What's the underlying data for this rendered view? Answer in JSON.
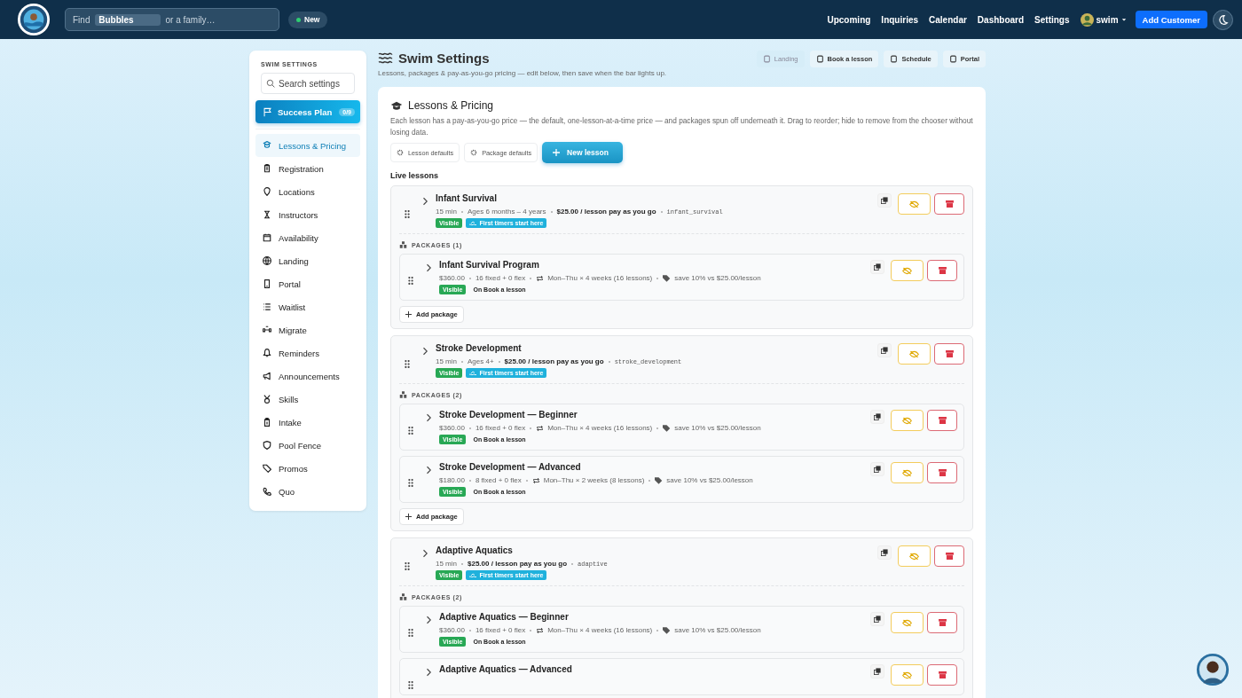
{
  "header": {
    "search": {
      "placeholder": "Find **Bubbles** or a family…"
    },
    "new_button": "New",
    "nav": [
      "Upcoming",
      "Inquiries",
      "Calendar",
      "Dashboard",
      "Settings"
    ],
    "user": "swim",
    "add_customer": "Add Customer"
  },
  "sidebar": {
    "heading": "SWIM SETTINGS",
    "search": {
      "placeholder": "Search settings"
    },
    "success_plan": {
      "label": "Success Plan",
      "count": "0/9"
    },
    "items": [
      {
        "label": "Lessons & Pricing",
        "selected": true
      },
      {
        "label": "Registration",
        "selected": false
      },
      {
        "label": "Locations",
        "selected": false
      },
      {
        "label": "Instructors",
        "selected": false
      },
      {
        "label": "Availability",
        "selected": false
      },
      {
        "label": "Landing",
        "selected": false
      },
      {
        "label": "Portal",
        "selected": false
      },
      {
        "label": "Waitlist",
        "selected": false
      },
      {
        "label": "Migrate",
        "selected": false
      },
      {
        "label": "Reminders",
        "selected": false
      },
      {
        "label": "Announcements",
        "selected": false
      },
      {
        "label": "Skills",
        "selected": false
      },
      {
        "label": "Intake",
        "selected": false
      },
      {
        "label": "Pool Fence",
        "selected": false
      },
      {
        "label": "Promos",
        "selected": false
      },
      {
        "label": "Quo",
        "selected": false
      }
    ]
  },
  "page": {
    "title": "Swim Settings",
    "subtitle": "Lessons, packages & pay-as-you-go pricing — edit below, then save when the bar lights up.",
    "links": [
      {
        "label": "Landing",
        "disabled": true
      },
      {
        "label": "Book a lesson",
        "disabled": false
      },
      {
        "label": "Schedule",
        "disabled": false
      },
      {
        "label": "Portal",
        "disabled": false
      }
    ]
  },
  "card": {
    "title": "Lessons & Pricing",
    "description": "Each lesson has a pay-as-you-go price — the default, one-lesson-at-a-time price — and packages spun off underneath it. Drag to reorder; hide to remove from the chooser without losing data.",
    "buttons": [
      "Lesson defaults",
      "Package defaults"
    ],
    "new_lesson": "New lesson",
    "section": "Live lessons",
    "lessons": [
      {
        "name": "Infant Survival",
        "duration": "15 min",
        "ages": "Ages 6 months – 4 years",
        "price": "$25.00 / lesson pay as you go",
        "slug": "infant_survival",
        "status": "Visible",
        "visible": true,
        "tag": "First timers start here",
        "packages_label": "PACKAGES (1)",
        "add_package": "Add package",
        "packages": [
          {
            "name": "Infant Survival Program",
            "price": "$360.00",
            "sessions": "16 fixed + 0 flex",
            "schedule": "Mon–Thu × 4 weeks (16 lessons)",
            "savings": "save 10% vs $25.00/lesson",
            "status": "Visible",
            "visible": true,
            "placement": "On Book a lesson"
          }
        ]
      },
      {
        "name": "Stroke Development",
        "duration": "15 min",
        "ages": "Ages 4+",
        "price": "$25.00 / lesson pay as you go",
        "slug": "stroke_development",
        "status": "Visible",
        "visible": true,
        "tag": "First timers start here",
        "packages_label": "PACKAGES (2)",
        "add_package": "Add package",
        "packages": [
          {
            "name": "Stroke Development — Beginner",
            "price": "$360.00",
            "sessions": "16 fixed + 0 flex",
            "schedule": "Mon–Thu × 4 weeks (16 lessons)",
            "savings": "save 10% vs $25.00/lesson",
            "status": "Visible",
            "visible": true,
            "placement": "On Book a lesson"
          },
          {
            "name": "Stroke Development — Advanced",
            "price": "$180.00",
            "sessions": "8 fixed + 0 flex",
            "schedule": "Mon–Thu × 2 weeks (8 lessons)",
            "savings": "save 10% vs $25.00/lesson",
            "status": "Visible",
            "visible": true,
            "placement": "On Book a lesson"
          }
        ]
      },
      {
        "name": "Adaptive Aquatics",
        "duration": "15 min",
        "price": "$25.00 / lesson pay as you go",
        "slug": "adaptive",
        "status": "Visible",
        "visible": true,
        "tag": "First timers start here",
        "packages_label": "PACKAGES (2)",
        "packages": [
          {
            "name": "Adaptive Aquatics — Beginner",
            "price": "$360.00",
            "sessions": "16 fixed + 0 flex",
            "schedule": "Mon–Thu × 4 weeks (16 lessons)",
            "savings": "save 10% vs $25.00/lesson",
            "status": "Visible",
            "visible": true,
            "placement": "On Book a lesson"
          },
          {
            "name": "Adaptive Aquatics — Advanced"
          }
        ]
      }
    ]
  }
}
